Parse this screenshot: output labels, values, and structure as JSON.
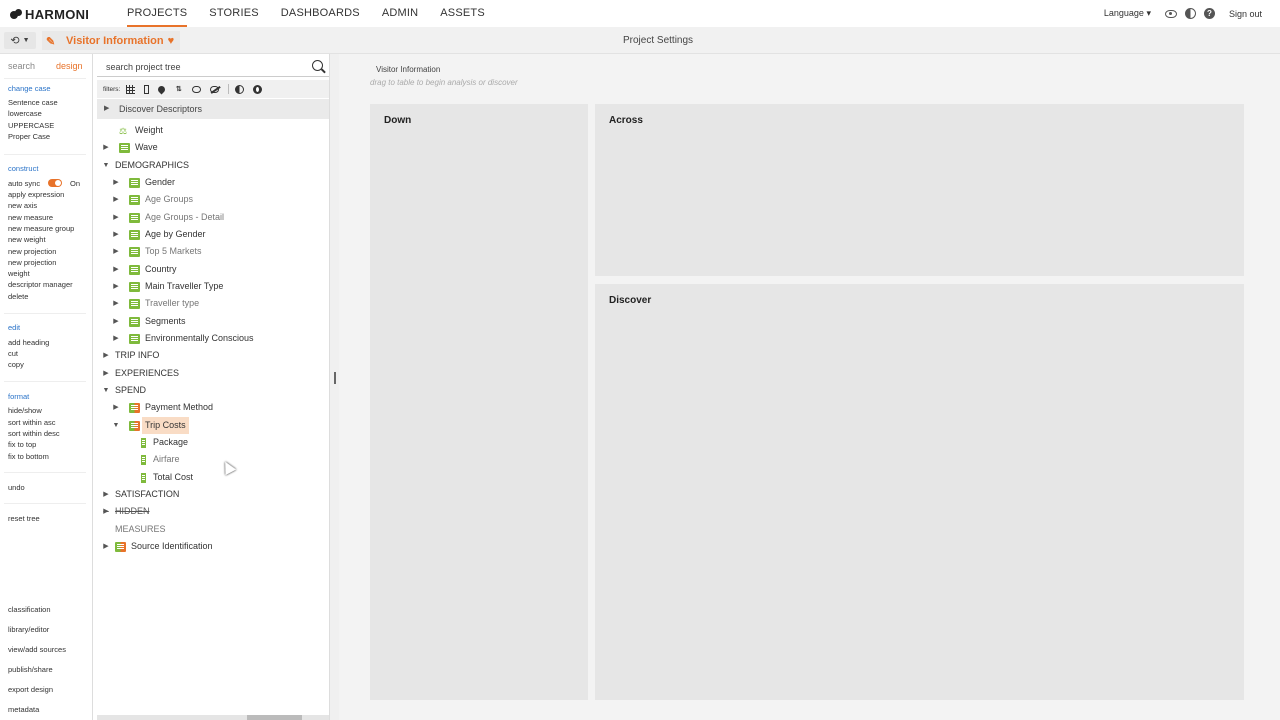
{
  "nav": {
    "logo": "HARMONI",
    "items": [
      {
        "label": "PROJECTS",
        "active": true
      },
      {
        "label": "STORIES",
        "active": false
      },
      {
        "label": "DASHBOARDS",
        "active": false
      },
      {
        "label": "ADMIN",
        "active": false
      },
      {
        "label": "ASSETS",
        "active": false
      }
    ],
    "language": "Language",
    "sign_out": "Sign out"
  },
  "subbar": {
    "tab_title": "Visitor Information",
    "center_title": "Project Settings"
  },
  "rail": {
    "tab_search": "search",
    "tab_design": "design",
    "change_case": {
      "heading": "change case",
      "items": [
        "Sentence case",
        "lowercase",
        "UPPERCASE",
        "Proper Case"
      ]
    },
    "construct": {
      "heading": "construct",
      "auto_sync_label": "auto sync",
      "auto_sync_state": "On",
      "items": [
        "apply expression",
        "new axis",
        "new measure",
        "new measure group",
        "new weight",
        "new projection",
        "new projection",
        "weight",
        "descriptor manager",
        "delete"
      ]
    },
    "edit": {
      "heading": "edit",
      "items": [
        "add heading",
        "cut",
        "copy"
      ]
    },
    "format": {
      "heading": "format",
      "items": [
        "hide/show",
        "sort within asc",
        "sort within desc",
        "fix to top",
        "fix to bottom"
      ]
    },
    "undo": "undo",
    "reset_tree": "reset tree",
    "bottom_items": [
      "classification",
      "library/editor",
      "view/add sources",
      "publish/share",
      "export design",
      "metadata"
    ]
  },
  "tree_panel": {
    "search_placeholder": "search project tree",
    "filters_label": "filters:",
    "discover_descriptors": "Discover Descriptors",
    "nodes": [
      {
        "label": "Weight"
      },
      {
        "label": "Wave"
      },
      {
        "label": "DEMOGRAPHICS"
      },
      {
        "label": "Gender"
      },
      {
        "label": "Age Groups"
      },
      {
        "label": "Age Groups - Detail"
      },
      {
        "label": "Age by Gender"
      },
      {
        "label": "Top 5 Markets"
      },
      {
        "label": "Country"
      },
      {
        "label": "Main Traveller Type"
      },
      {
        "label": "Traveller type"
      },
      {
        "label": "Segments"
      },
      {
        "label": "Environmentally Conscious"
      },
      {
        "label": "TRIP INFO"
      },
      {
        "label": "EXPERIENCES"
      },
      {
        "label": "SPEND"
      },
      {
        "label": "Payment Method"
      },
      {
        "label": "Trip Costs"
      },
      {
        "label": "Package"
      },
      {
        "label": "Airfare"
      },
      {
        "label": "Total Cost"
      },
      {
        "label": "SATISFACTION"
      },
      {
        "label": "HIDDEN"
      },
      {
        "label": "MEASURES"
      },
      {
        "label": "Source Identification"
      }
    ]
  },
  "main": {
    "title": "Visitor Information",
    "hint": "drag to table to begin analysis or discover",
    "panel_down": "Down",
    "panel_across": "Across",
    "panel_discover": "Discover"
  },
  "colors": {
    "accent": "#e8732a",
    "field_icon": "#7fba3c",
    "link": "#2a73c8"
  }
}
